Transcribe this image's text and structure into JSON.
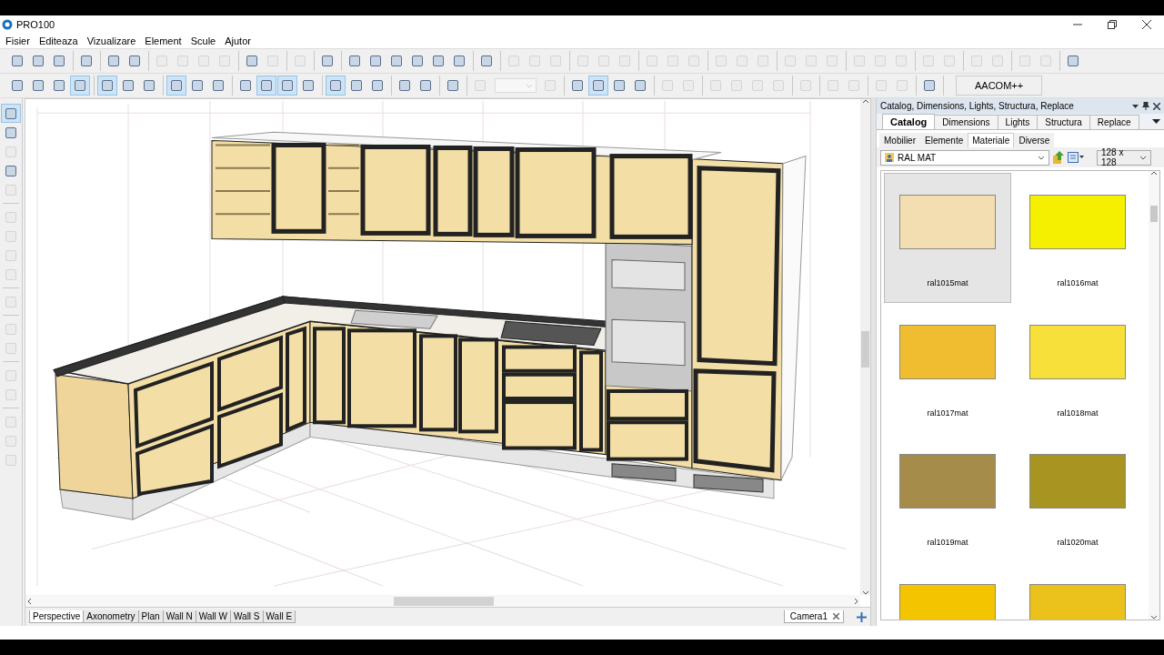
{
  "window": {
    "title": "PRO100"
  },
  "menu": [
    "Fisier",
    "Editeaza",
    "Vizualizare",
    "Element",
    "Scule",
    "Ajutor"
  ],
  "toolbar_1": [
    [
      {
        "disabled": false
      },
      {
        "disabled": false
      },
      {
        "disabled": false
      }
    ],
    [
      {
        "disabled": false
      }
    ],
    [
      {
        "disabled": false
      },
      {
        "disabled": false
      }
    ],
    [
      {
        "disabled": true
      },
      {
        "disabled": true
      },
      {
        "disabled": true
      },
      {
        "disabled": true
      }
    ],
    [
      {
        "disabled": false
      },
      {
        "disabled": true
      }
    ],
    [
      {
        "disabled": true
      }
    ],
    [
      {
        "disabled": false
      }
    ],
    [
      {
        "disabled": false
      },
      {
        "disabled": false
      },
      {
        "disabled": false
      },
      {
        "disabled": false
      },
      {
        "disabled": false
      },
      {
        "disabled": false
      }
    ],
    [
      {
        "disabled": false
      }
    ],
    [
      {
        "disabled": true
      },
      {
        "disabled": true
      },
      {
        "disabled": true
      }
    ],
    [
      {
        "disabled": true
      },
      {
        "disabled": true
      },
      {
        "disabled": true
      }
    ],
    [
      {
        "disabled": true
      },
      {
        "disabled": true
      },
      {
        "disabled": true
      }
    ],
    [
      {
        "disabled": true
      },
      {
        "disabled": true
      },
      {
        "disabled": true
      }
    ],
    [
      {
        "disabled": true
      },
      {
        "disabled": true
      },
      {
        "disabled": true
      }
    ],
    [
      {
        "disabled": true
      },
      {
        "disabled": true
      },
      {
        "disabled": true
      }
    ],
    [
      {
        "disabled": true
      },
      {
        "disabled": true
      }
    ],
    [
      {
        "disabled": true
      },
      {
        "disabled": true
      }
    ],
    [
      {
        "disabled": true
      },
      {
        "disabled": true
      }
    ],
    [
      {
        "disabled": false
      }
    ]
  ],
  "toolbar_2": [
    [
      {
        "selected": false,
        "disabled": false
      },
      {
        "selected": false,
        "disabled": false
      },
      {
        "selected": false,
        "disabled": false
      },
      {
        "selected": true,
        "disabled": false
      }
    ],
    [
      {
        "selected": true,
        "disabled": false
      },
      {
        "selected": false,
        "disabled": false
      },
      {
        "selected": false,
        "disabled": false
      }
    ],
    [
      {
        "selected": true,
        "disabled": false
      },
      {
        "selected": false,
        "disabled": false
      },
      {
        "selected": false,
        "disabled": false
      }
    ],
    [
      {
        "selected": false,
        "disabled": false
      },
      {
        "selected": true,
        "disabled": false
      },
      {
        "selected": true,
        "disabled": false
      },
      {
        "selected": false,
        "disabled": false
      }
    ],
    [
      {
        "selected": true,
        "disabled": false
      },
      {
        "selected": false,
        "disabled": false
      },
      {
        "selected": false,
        "disabled": false
      }
    ],
    [
      {
        "selected": false,
        "disabled": false
      },
      {
        "selected": false,
        "disabled": false
      }
    ],
    [
      {
        "selected": false,
        "disabled": false
      }
    ],
    [
      {
        "selected": false,
        "disabled": true
      },
      {
        "selected": false,
        "disabled": true
      }
    ],
    [
      {
        "selected": false,
        "disabled": false
      },
      {
        "selected": true,
        "disabled": false
      },
      {
        "selected": false,
        "disabled": false
      },
      {
        "selected": false,
        "disabled": false
      }
    ],
    [
      {
        "selected": false,
        "disabled": true
      },
      {
        "selected": false,
        "disabled": true
      }
    ],
    [
      {
        "selected": false,
        "disabled": true
      },
      {
        "selected": false,
        "disabled": true
      },
      {
        "selected": false,
        "disabled": true
      },
      {
        "selected": false,
        "disabled": true
      }
    ],
    [
      {
        "selected": false,
        "disabled": true
      }
    ],
    [
      {
        "selected": false,
        "disabled": true
      },
      {
        "selected": false,
        "disabled": true
      }
    ],
    [
      {
        "selected": false,
        "disabled": true
      },
      {
        "selected": false,
        "disabled": true
      }
    ],
    [
      {
        "selected": false,
        "disabled": false
      }
    ]
  ],
  "zoom_field": {
    "disabled": true
  },
  "toolbar_2_button": "AACOM++",
  "left_tools": [
    [
      {
        "selected": true,
        "disabled": false
      },
      {
        "selected": false,
        "disabled": false
      },
      {
        "selected": false,
        "disabled": true
      },
      {
        "selected": false,
        "disabled": false
      },
      {
        "selected": false,
        "disabled": true
      }
    ],
    [
      {
        "selected": false,
        "disabled": true
      },
      {
        "selected": false,
        "disabled": true
      },
      {
        "selected": false,
        "disabled": true
      },
      {
        "selected": false,
        "disabled": true
      }
    ],
    [
      {
        "selected": false,
        "disabled": true
      }
    ],
    [
      {
        "selected": false,
        "disabled": true
      },
      {
        "selected": false,
        "disabled": true
      }
    ],
    [
      {
        "selected": false,
        "disabled": true
      },
      {
        "selected": false,
        "disabled": true
      }
    ],
    [
      {
        "selected": false,
        "disabled": true
      },
      {
        "selected": false,
        "disabled": true
      },
      {
        "selected": false,
        "disabled": true
      }
    ]
  ],
  "view_tabs": [
    {
      "label": "Perspective",
      "selected": true
    },
    {
      "label": "Axonometry",
      "selected": false
    },
    {
      "label": "Plan",
      "selected": false
    },
    {
      "label": "Wall N",
      "selected": false
    },
    {
      "label": "Wall W",
      "selected": false
    },
    {
      "label": "Wall S",
      "selected": false
    },
    {
      "label": "Wall E",
      "selected": false
    }
  ],
  "camera_tab": {
    "label": "Camera1"
  },
  "panel": {
    "title": "Catalog, Dimensions, Lights, Structura, Replace",
    "tabs": [
      {
        "label": "Catalog",
        "selected": true
      },
      {
        "label": "Dimensions",
        "selected": false
      },
      {
        "label": "Lights",
        "selected": false
      },
      {
        "label": "Structura",
        "selected": false
      },
      {
        "label": "Replace",
        "selected": false
      }
    ],
    "subtabs": [
      {
        "label": "Mobilier",
        "selected": false
      },
      {
        "label": "Elemente",
        "selected": false
      },
      {
        "label": "Materiale",
        "selected": true
      },
      {
        "label": "Diverse",
        "selected": false
      }
    ],
    "library": "RAL MAT",
    "thumb_size": "128 x 128",
    "swatches": [
      {
        "label": "ral1015mat",
        "color": "#f2deb0",
        "selected": true
      },
      {
        "label": "ral1016mat",
        "color": "#f5f000",
        "selected": false
      },
      {
        "label": "ral1017mat",
        "color": "#f0bc30",
        "selected": false
      },
      {
        "label": "ral1018mat",
        "color": "#f7e03a",
        "selected": false
      },
      {
        "label": "ral1019mat",
        "color": "#a68c4a",
        "selected": false
      },
      {
        "label": "ral1020mat",
        "color": "#a89420",
        "selected": false
      },
      {
        "color": "#f5c400",
        "selected": false
      },
      {
        "color": "#ebc21c",
        "selected": false
      }
    ]
  }
}
